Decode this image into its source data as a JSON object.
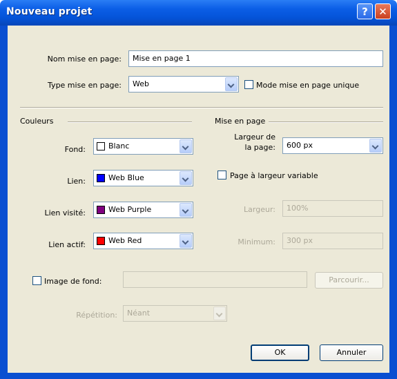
{
  "window": {
    "title": "Nouveau projet",
    "help_label": "?",
    "close_label": "✕"
  },
  "layout_name": {
    "label": "Nom mise en page:",
    "value": "Mise en page 1"
  },
  "layout_type": {
    "label": "Type mise en page:",
    "value": "Web",
    "single_mode_label": "Mode mise en page unique"
  },
  "colors": {
    "heading": "Couleurs",
    "fond": {
      "label": "Fond:",
      "value": "Blanc",
      "swatch": "#ffffff"
    },
    "lien": {
      "label": "Lien:",
      "value": "Web Blue",
      "swatch": "#0000ff"
    },
    "lien_visite": {
      "label": "Lien visité:",
      "value": "Web Purple",
      "swatch": "#800080"
    },
    "lien_actif": {
      "label": "Lien actif:",
      "value": "Web Red",
      "swatch": "#ff0000"
    }
  },
  "page_setup": {
    "heading": "Mise en page",
    "width_label_1": "Largeur de",
    "width_label_2": "la page:",
    "width_value": "600 px",
    "variable_label": "Page à largeur variable",
    "largeur_label": "Largeur:",
    "largeur_value": "100%",
    "minimum_label": "Minimum:",
    "minimum_value": "300 px"
  },
  "background_image": {
    "label": "Image de fond:",
    "value": "",
    "browse_label": "Parcourir...",
    "repeat_label": "Répétition:",
    "repeat_value": "Néant"
  },
  "buttons": {
    "ok": "OK",
    "cancel": "Annuler"
  }
}
